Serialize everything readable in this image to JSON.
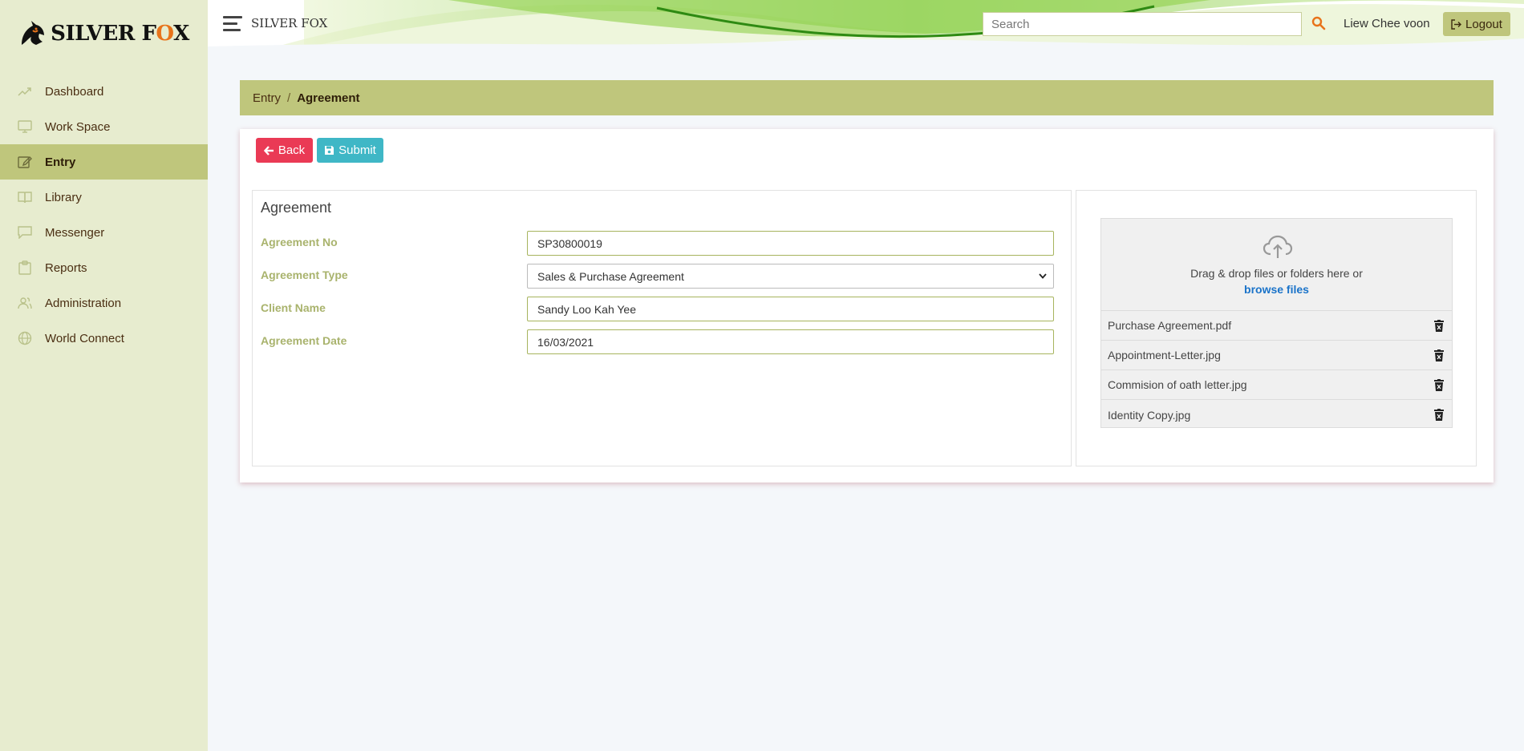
{
  "brand": {
    "logo_text_main": "SILVER F",
    "logo_text_accent": "O",
    "logo_text_end": "X",
    "app_title": "SILVER FOX"
  },
  "sidebar": {
    "items": [
      {
        "label": "Dashboard",
        "icon": "trend-icon"
      },
      {
        "label": "Work Space",
        "icon": "monitor-icon"
      },
      {
        "label": "Entry",
        "icon": "edit-icon",
        "active": true
      },
      {
        "label": "Library",
        "icon": "book-icon"
      },
      {
        "label": "Messenger",
        "icon": "chat-icon"
      },
      {
        "label": "Reports",
        "icon": "clipboard-icon"
      },
      {
        "label": "Administration",
        "icon": "users-icon"
      },
      {
        "label": "World Connect",
        "icon": "globe-icon"
      }
    ]
  },
  "header": {
    "search_placeholder": "Search",
    "user_name": "Liew Chee voon",
    "logout_label": "Logout"
  },
  "breadcrumb": {
    "parent": "Entry",
    "separator": "/",
    "current": "Agreement"
  },
  "toolbar": {
    "back_label": "Back",
    "submit_label": "Submit"
  },
  "form": {
    "title": "Agreement",
    "agreement_no_label": "Agreement No",
    "agreement_no_value": "SP30800019",
    "agreement_type_label": "Agreement Type",
    "agreement_type_value": "Sales & Purchase Agreement",
    "client_name_label": "Client Name",
    "client_name_value": "Sandy Loo Kah Yee",
    "agreement_date_label": "Agreement Date",
    "agreement_date_value": "16/03/2021"
  },
  "uploader": {
    "drop_text": "Drag & drop files or folders here or",
    "browse_label": "browse files",
    "files": [
      "Purchase Agreement.pdf",
      "Appointment-Letter.jpg",
      "Commision of oath letter.jpg",
      "Identity Copy.jpg"
    ]
  },
  "colors": {
    "sidebar_bg": "#e7eccf",
    "accent_olive": "#bfc67c",
    "back_red": "#ea3a55",
    "submit_teal": "#3fb7c6",
    "link_blue": "#1a73c9"
  }
}
